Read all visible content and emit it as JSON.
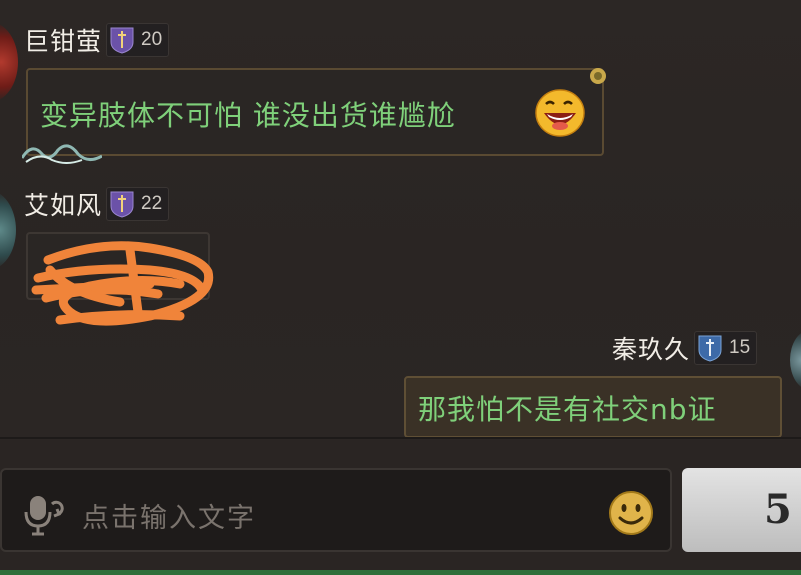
{
  "messages": [
    {
      "sender": "巨钳萤",
      "rank_level": "20",
      "text": "变异肢体不可怕 谁没出货谁尴尬",
      "emoji": "grinning-face-icon"
    },
    {
      "sender": "艾如风",
      "rank_level": "22",
      "text": "",
      "redacted": true
    },
    {
      "sender": "秦玖久",
      "rank_level": "15",
      "text": "那我怕不是有社交nb证"
    }
  ],
  "input": {
    "placeholder": "点击输入文字",
    "send_label": "5"
  },
  "colors": {
    "message_text": "#7fd07a",
    "background": "#2a2523",
    "redaction_scribble": "#f0843a"
  }
}
